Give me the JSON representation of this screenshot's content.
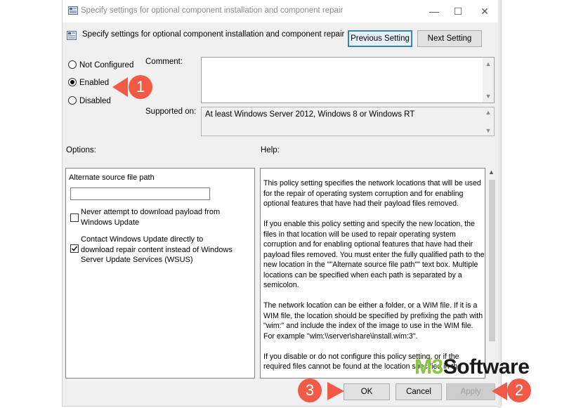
{
  "window": {
    "title": "Specify settings for optional component installation and component repair",
    "minimize": "—",
    "maximize": "☐",
    "close": "✕"
  },
  "header": {
    "title": "Specify settings for optional component installation and component repair",
    "previous_button": "Previous Setting",
    "next_button": "Next Setting"
  },
  "state": {
    "options": [
      {
        "label": "Not Configured",
        "selected": false
      },
      {
        "label": "Enabled",
        "selected": true
      },
      {
        "label": "Disabled",
        "selected": false
      }
    ]
  },
  "comment_label": "Comment:",
  "supported_label": "Supported on:",
  "supported_value": "At least Windows Server 2012, Windows 8 or Windows RT",
  "options_label": "Options:",
  "help_label": "Help:",
  "options_panel": {
    "alt_source_label": "Alternate source file path",
    "alt_source_value": "",
    "check1": {
      "label": "Never attempt to download payload from Windows Update",
      "checked": false
    },
    "check2": {
      "label": "Contact Windows Update directly to download repair content instead of Windows Server Update Services (WSUS)",
      "checked": true
    }
  },
  "help_panel": {
    "p1": "This policy setting specifies the network locations that will be used for the repair of operating system corruption and for enabling optional features that have had their payload files removed.",
    "p2": "If you enable this policy setting and specify the new location, the files in that location will be used to repair operating system corruption and for enabling optional features that have had their payload files removed. You must enter the fully qualified path to the new location in the \"\"Alternate source file path\"\" text box. Multiple locations can be specified when each path is separated by a semicolon.",
    "p3": "The network location can be either a folder, or a WIM file. If it is a WIM file, the location should be specified by prefixing the path with \"wim:\" and include the index of the image to use in the WIM file. For example \"wim:\\\\server\\share\\install.wim:3\".",
    "p4": "If you disable or do not configure this policy setting, or if the required files cannot be found at the location specified in the"
  },
  "footer": {
    "ok": "OK",
    "cancel": "Cancel",
    "apply": "Apply"
  },
  "callouts": {
    "one": "1",
    "two": "2",
    "three": "3"
  },
  "watermark": {
    "prefix": "M3",
    "suffix": "Software"
  },
  "colors": {
    "callout": "#f15a47",
    "accent": "#3c7fb1",
    "watermark_green": "#8bc53f"
  }
}
